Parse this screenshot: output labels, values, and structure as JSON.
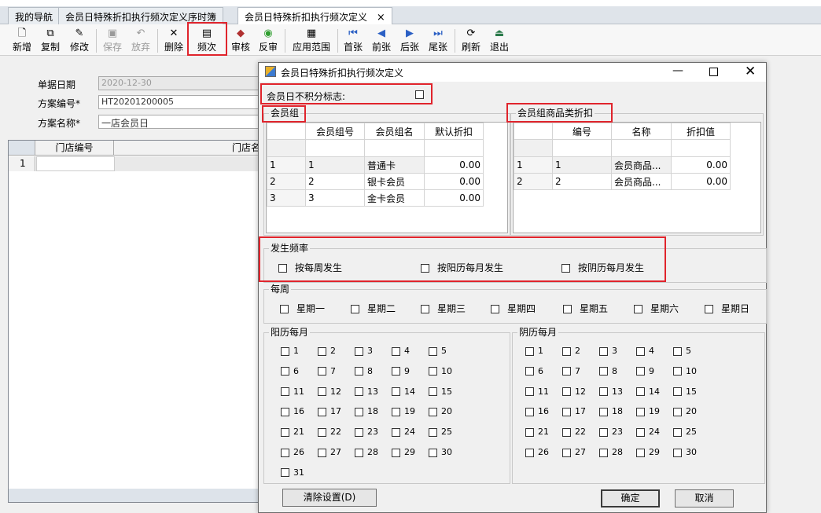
{
  "tabs": [
    "我的导航",
    "会员日特殊折扣执行频次定义序时簿",
    "会员日特殊折扣执行频次定义"
  ],
  "tab_close": "×",
  "toolbar": [
    {
      "label": "新增",
      "icon": "🗋",
      "disabled": false
    },
    {
      "label": "复制",
      "icon": "⧉",
      "disabled": false
    },
    {
      "label": "修改",
      "icon": "✎",
      "disabled": false
    },
    {
      "label": "保存",
      "icon": "▣",
      "disabled": true
    },
    {
      "label": "放弃",
      "icon": "↶",
      "disabled": true
    },
    {
      "label": "删除",
      "icon": "✕",
      "disabled": false
    },
    {
      "label": "频次",
      "icon": "▤",
      "disabled": false
    },
    {
      "label": "审核",
      "icon": "◆",
      "disabled": false
    },
    {
      "label": "反审",
      "icon": "◉",
      "disabled": false
    },
    {
      "label": "应用范围",
      "icon": "▦",
      "disabled": false
    },
    {
      "label": "首张",
      "icon": "⏮",
      "disabled": false
    },
    {
      "label": "前张",
      "icon": "◀",
      "disabled": false
    },
    {
      "label": "后张",
      "icon": "▶",
      "disabled": false
    },
    {
      "label": "尾张",
      "icon": "⏭",
      "disabled": false
    },
    {
      "label": "刷新",
      "icon": "⟳",
      "disabled": false
    },
    {
      "label": "退出",
      "icon": "⏏",
      "disabled": false
    }
  ],
  "form": {
    "date_label": "单据日期",
    "date_value": "2020-12-30",
    "code_label": "方案编号*",
    "code_value": "HT20201200005",
    "name_label": "方案名称*",
    "name_value": "一店会员日"
  },
  "bg_grid": {
    "headers": [
      "门店编号",
      "门店名"
    ],
    "row1": "1"
  },
  "dialog": {
    "title": "会员日特殊折扣执行频次定义",
    "no_points_label": "会员日不积分标志:",
    "member_group": {
      "title": "会员组",
      "headers": [
        "会员组号",
        "会员组名",
        "默认折扣"
      ],
      "rows": [
        [
          "1",
          "1",
          "普通卡",
          "0.00"
        ],
        [
          "2",
          "2",
          "银卡会员",
          "0.00"
        ],
        [
          "3",
          "3",
          "金卡会员",
          "0.00"
        ]
      ]
    },
    "category_discount": {
      "title": "会员组商品类折扣",
      "headers": [
        "编号",
        "名称",
        "折扣值"
      ],
      "rows": [
        [
          "1",
          "1",
          "会员商品...",
          "0.00"
        ],
        [
          "2",
          "2",
          "会员商品...",
          "0.00"
        ]
      ]
    },
    "frequency": {
      "title": "发生频率",
      "options": [
        "按每周发生",
        "按阳历每月发生",
        "按阴历每月发生"
      ]
    },
    "weekly": {
      "title": "每周",
      "days": [
        "星期一",
        "星期二",
        "星期三",
        "星期四",
        "星期五",
        "星期六",
        "星期日"
      ]
    },
    "solar": {
      "title": "阳历每月",
      "days": [
        "1",
        "2",
        "3",
        "4",
        "5",
        "6",
        "7",
        "8",
        "9",
        "10",
        "11",
        "12",
        "13",
        "14",
        "15",
        "16",
        "17",
        "18",
        "19",
        "20",
        "21",
        "22",
        "23",
        "24",
        "25",
        "26",
        "27",
        "28",
        "29",
        "30",
        "31"
      ]
    },
    "lunar": {
      "title": "阴历每月",
      "days": [
        "1",
        "2",
        "3",
        "4",
        "5",
        "6",
        "7",
        "8",
        "9",
        "10",
        "11",
        "12",
        "13",
        "14",
        "15",
        "16",
        "17",
        "18",
        "19",
        "20",
        "21",
        "22",
        "23",
        "24",
        "25",
        "26",
        "27",
        "28",
        "29",
        "30"
      ]
    },
    "clear_button": "清除设置(D)",
    "ok_button": "确定",
    "cancel_button": "取消"
  },
  "colors": {
    "highlight": "#e0242c",
    "tab_bg": "#dfe4ea"
  }
}
